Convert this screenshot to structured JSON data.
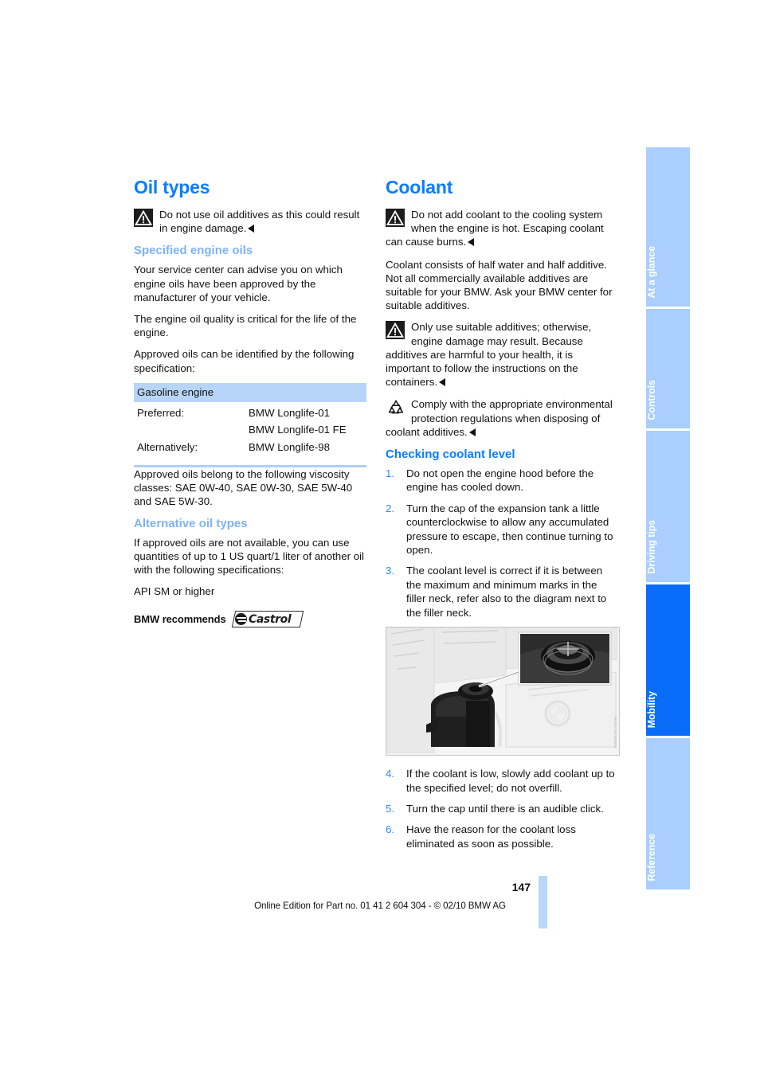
{
  "document": {
    "page_number": "147",
    "footer_note": "Online Edition for Part no. 01 41 2 604 304 - © 02/10 BMW AG"
  },
  "left_column": {
    "section_title": "Oil types",
    "warning_oil_additives": "Do not use oil additives as this could result in engine damage.",
    "specified_engine_oils": {
      "title": "Specified engine oils",
      "paragraph_1": "Your service center can advise you on which engine oils have been approved by the manufacturer of your vehicle.",
      "paragraph_2": "The engine oil quality is critical for the life of the engine.",
      "paragraph_3": "Approved oils can be identified by the following specification:"
    },
    "spec_table": {
      "header": "Gasoline engine",
      "rows": [
        {
          "label": "Preferred:",
          "value_line_1": "BMW Longlife-01",
          "value_line_2": "BMW Longlife-01 FE"
        },
        {
          "label": "Alternatively:",
          "value_line_1": "BMW Longlife-98",
          "value_line_2": ""
        }
      ]
    },
    "viscosity_paragraph": "Approved oils belong to the following viscosity classes: SAE 0W-40, SAE 0W-30, SAE 5W-40 and SAE 5W-30.",
    "alternative_oil_types": {
      "title": "Alternative oil types",
      "paragraph_1": "If approved oils are not available, you can use quantities of up to 1 US quart/1 liter of another oil with the following specifications:",
      "paragraph_2": "API SM or higher"
    },
    "recommends": {
      "label": "BMW recommends",
      "brand": "Castrol"
    }
  },
  "right_column": {
    "section_title": "Coolant",
    "warning_hot_engine": "Do not add coolant to the cooling system when the engine is hot. Escaping coolant can cause burns.",
    "coolant_paragraph": "Coolant consists of half water and half additive. Not all commercially available additives are suitable for your BMW. Ask your BMW center for suitable additives.",
    "warning_additives": "Only use suitable additives; otherwise, engine damage may result. Because additives are harmful to your health, it is important to follow the instructions on the containers.",
    "note_environment": "Comply with the appropriate environmental protection regulations when disposing of coolant additives.",
    "checking_coolant_level": {
      "title": "Checking coolant level",
      "steps_before_figure": [
        {
          "num": "1.",
          "text": "Do not open the engine hood before the engine has cooled down."
        },
        {
          "num": "2.",
          "text": "Turn the cap of the expansion tank a little counterclockwise to allow any accumulated pressure to escape, then continue turning to open."
        },
        {
          "num": "3.",
          "text": "The coolant level is correct if it is between the maximum and minimum marks in the filler neck, refer also to the diagram next to the filler neck."
        }
      ],
      "steps_after_figure": [
        {
          "num": "4.",
          "text": "If the coolant is low, slowly add coolant up to the specified level; do not overfill."
        },
        {
          "num": "5.",
          "text": "Turn the cap until there is an audible click."
        },
        {
          "num": "6.",
          "text": "Have the reason for the coolant loss eliminated as soon as possible."
        }
      ]
    },
    "figure_code": "W620.110.003ER"
  },
  "tabs": [
    {
      "label": "At a glance",
      "active": false
    },
    {
      "label": "Controls",
      "active": false
    },
    {
      "label": "Driving tips",
      "active": false
    },
    {
      "label": "Mobility",
      "active": true
    },
    {
      "label": "Reference",
      "active": false
    }
  ],
  "colors": {
    "heading_blue": "#0a7cff",
    "subheading_blue": "#7eb3f5",
    "step_number_blue": "#2f8bff",
    "table_header_band": "#b7d5f8",
    "tab_inactive": "#a9ceff",
    "tab_active": "#0a6dfa"
  }
}
